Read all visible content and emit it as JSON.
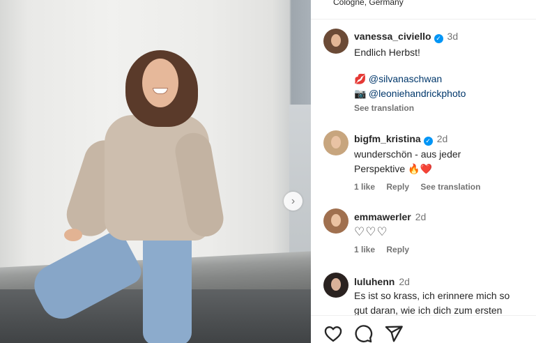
{
  "post": {
    "location": "Cologne, Germany",
    "next_arrow": "›"
  },
  "comments": [
    {
      "username": "vanessa_civiello",
      "verified": true,
      "time": "3d",
      "lines": [
        "Endlich Herbst!"
      ],
      "credits": [
        {
          "emoji": "💋",
          "mention": "@silvanaschwan"
        },
        {
          "emoji": "📷",
          "mention": "@leoniehandrickphoto"
        }
      ],
      "see_translation": "See translation"
    },
    {
      "username": "bigfm_kristina",
      "verified": true,
      "time": "2d",
      "lines": [
        "wunderschön - aus jeder",
        "Perspektive 🔥❤️"
      ],
      "likes": "1 like",
      "reply": "Reply",
      "see_translation": "See translation"
    },
    {
      "username": "emmawerler",
      "verified": false,
      "time": "2d",
      "lines": [
        "♡♡♡"
      ],
      "likes": "1 like",
      "reply": "Reply"
    },
    {
      "username": "luluhenn",
      "verified": false,
      "time": "2d",
      "lines": [
        "Es ist so krass, ich erinnere mich so",
        "gut daran, wie ich dich zum ersten"
      ]
    }
  ],
  "icons": {
    "like": "heart-icon",
    "comment": "comment-icon",
    "share": "share-icon"
  },
  "colors": {
    "verified": "#0095f6",
    "mention": "#00376b",
    "muted": "#737373"
  }
}
